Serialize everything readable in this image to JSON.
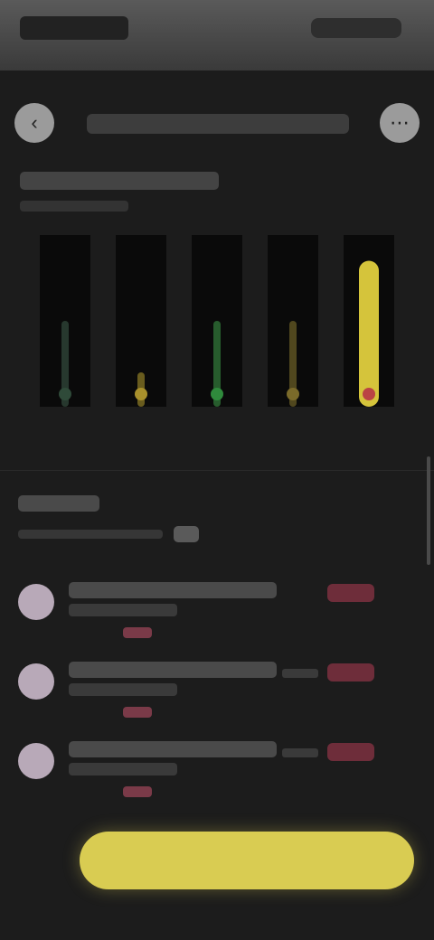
{
  "status_bar": {
    "time": "",
    "indicators": ""
  },
  "header": {
    "back_icon": "arrow-left-icon",
    "title": "",
    "more_icon": "more-icon"
  },
  "summary": {
    "title": "",
    "subtitle": ""
  },
  "chart_data": {
    "type": "bar",
    "categories": [
      "",
      "",
      "",
      "",
      ""
    ],
    "values": [
      0.5,
      0.2,
      0.5,
      0.5,
      0.85
    ],
    "series_colors": [
      "#3f5e4c",
      "#b8a030",
      "#3fa04a",
      "#8a7a30",
      "#e0cf3e"
    ],
    "marker_colors": [
      "#2f4a39",
      "#a8902c",
      "#2f8a3c",
      "#7a6a2a",
      "#b44"
    ],
    "ylim": [
      0,
      1
    ]
  },
  "activity": {
    "title": "",
    "subtitle": "",
    "badge": "",
    "items": [
      {
        "line1": "",
        "line2": "",
        "tag": "",
        "badge": "",
        "meta": ""
      },
      {
        "line1": "",
        "line2": "",
        "tag": "",
        "badge": "",
        "meta": ""
      },
      {
        "line1": "",
        "line2": "",
        "tag": "",
        "badge": "",
        "meta": ""
      }
    ]
  },
  "cta": {
    "label": ""
  },
  "colors": {
    "background": "#1c1c1c",
    "accent": "#d9cc52",
    "badge": "#6e2d3a"
  }
}
